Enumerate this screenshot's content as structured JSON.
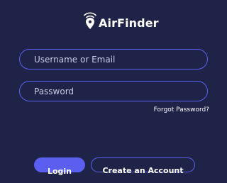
{
  "brand": {
    "name": "AirFinder",
    "logo_icon": "location-pin-wifi-icon"
  },
  "form": {
    "username_placeholder": "Username or Email",
    "username_value": "",
    "password_placeholder": "Password",
    "password_value": "",
    "forgot_label": "Forgot Password?"
  },
  "actions": {
    "login_label": "Login",
    "create_account_label": "Create an Account"
  },
  "colors": {
    "background": "#1f2347",
    "accent": "#5b5ff0",
    "text": "#ffffff"
  }
}
